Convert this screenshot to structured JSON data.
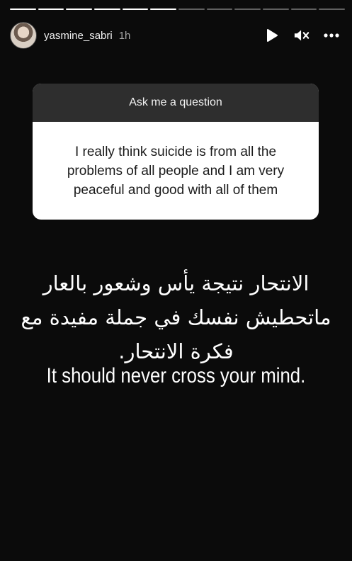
{
  "progress": {
    "total": 12,
    "current": 6
  },
  "header": {
    "username": "yasmine_sabri",
    "time": "1h",
    "icons": [
      "play-icon",
      "mute-icon",
      "more-icon"
    ]
  },
  "question_card": {
    "title": "Ask me a question",
    "answer": "I really think suicide is from all the problems of all people and I am very peaceful and good with all of them"
  },
  "caption": {
    "arabic_lines": [
      "الانتحار نتيجة يأس وشعور بالعار",
      "ماتحطيش نفسك في جملة مفيدة مع",
      "فكرة الانتحار."
    ],
    "english": "It should never cross your mind."
  },
  "colors": {
    "background": "#0b0b0b",
    "card_header": "#2e2e2e",
    "card_body": "#ffffff"
  }
}
